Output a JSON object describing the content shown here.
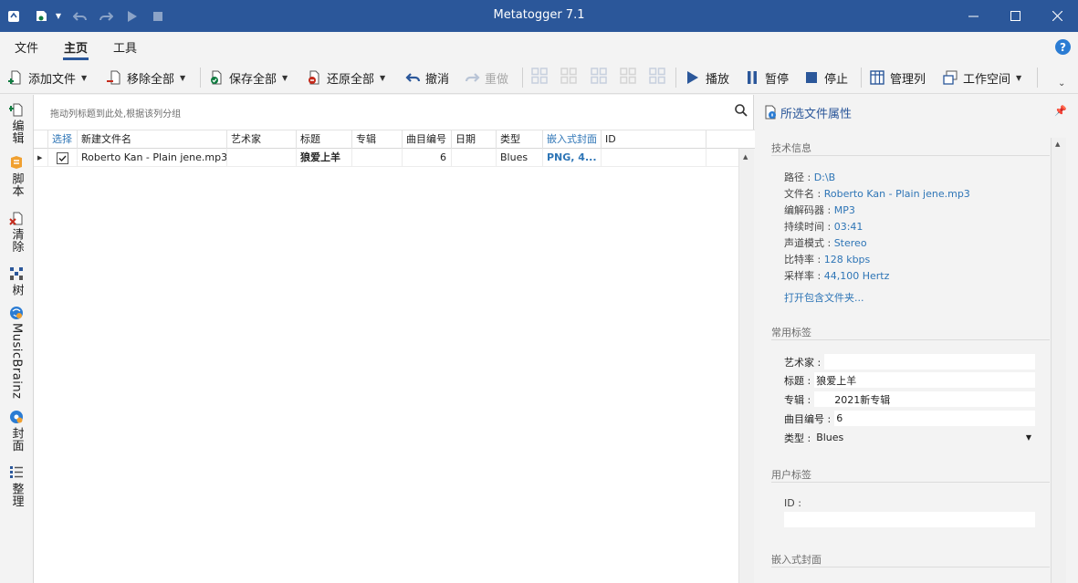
{
  "app": {
    "title": "Metatogger 7.1",
    "colors": {
      "brand": "#2b579a",
      "accent": "#2e75b6",
      "green": "#107c41",
      "red": "#c42b1c"
    }
  },
  "menu": {
    "file": "文件",
    "home": "主页",
    "tools": "工具",
    "help": "?"
  },
  "toolbar": {
    "add_files": "添加文件",
    "remove_all": "移除全部",
    "save_all": "保存全部",
    "restore_all": "还原全部",
    "undo": "撤消",
    "redo": "重做",
    "play": "播放",
    "pause": "暂停",
    "stop": "停止",
    "manage_columns": "管理列",
    "workspace": "工作空间"
  },
  "side_tabs": [
    "编辑",
    "脚本",
    "清除",
    "树",
    "MusicBrainz",
    "封面",
    "整理"
  ],
  "grid": {
    "group_hint": "拖动列标题到此处,根据该列分组",
    "columns": [
      "选择",
      "新建文件名",
      "艺术家",
      "标题",
      "专辑",
      "曲目编号",
      "日期",
      "类型",
      "嵌入式封面",
      "ID"
    ],
    "rows": [
      {
        "selected": true,
        "filename": "Roberto Kan - Plain jene.mp3",
        "artist": "",
        "title": "狼爱上羊",
        "album": "",
        "track": "6",
        "date": "",
        "genre": "Blues",
        "cover": "PNG, 4...",
        "id": ""
      }
    ]
  },
  "properties": {
    "header": "所选文件属性",
    "tech_section": "技术信息",
    "tech": [
      {
        "label": "路径 : ",
        "value": "D:\\B"
      },
      {
        "label": "文件名 : ",
        "value": "Roberto Kan - Plain jene.mp3"
      },
      {
        "label": "编解码器 : ",
        "value": "MP3"
      },
      {
        "label": "持续时间 : ",
        "value": "03:41"
      },
      {
        "label": "声道模式 : ",
        "value": "Stereo"
      },
      {
        "label": "比特率 : ",
        "value": "128 kbps"
      },
      {
        "label": "采样率 : ",
        "value": "44,100 Hertz"
      }
    ],
    "open_folder": "打开包含文件夹...",
    "common_section": "常用标签",
    "common": [
      {
        "label": "艺术家 :",
        "value": ""
      },
      {
        "label": "标题 :",
        "value": "狼爱上羊"
      },
      {
        "label": "专辑 :",
        "value": "2021新专辑"
      },
      {
        "label": "曲目编号 :",
        "value": "6"
      },
      {
        "label": "类型 :",
        "value": "Blues"
      }
    ],
    "user_section": "用户标签",
    "user_id_label": "ID :",
    "user_id_value": "",
    "cover_section": "嵌入式封面"
  }
}
